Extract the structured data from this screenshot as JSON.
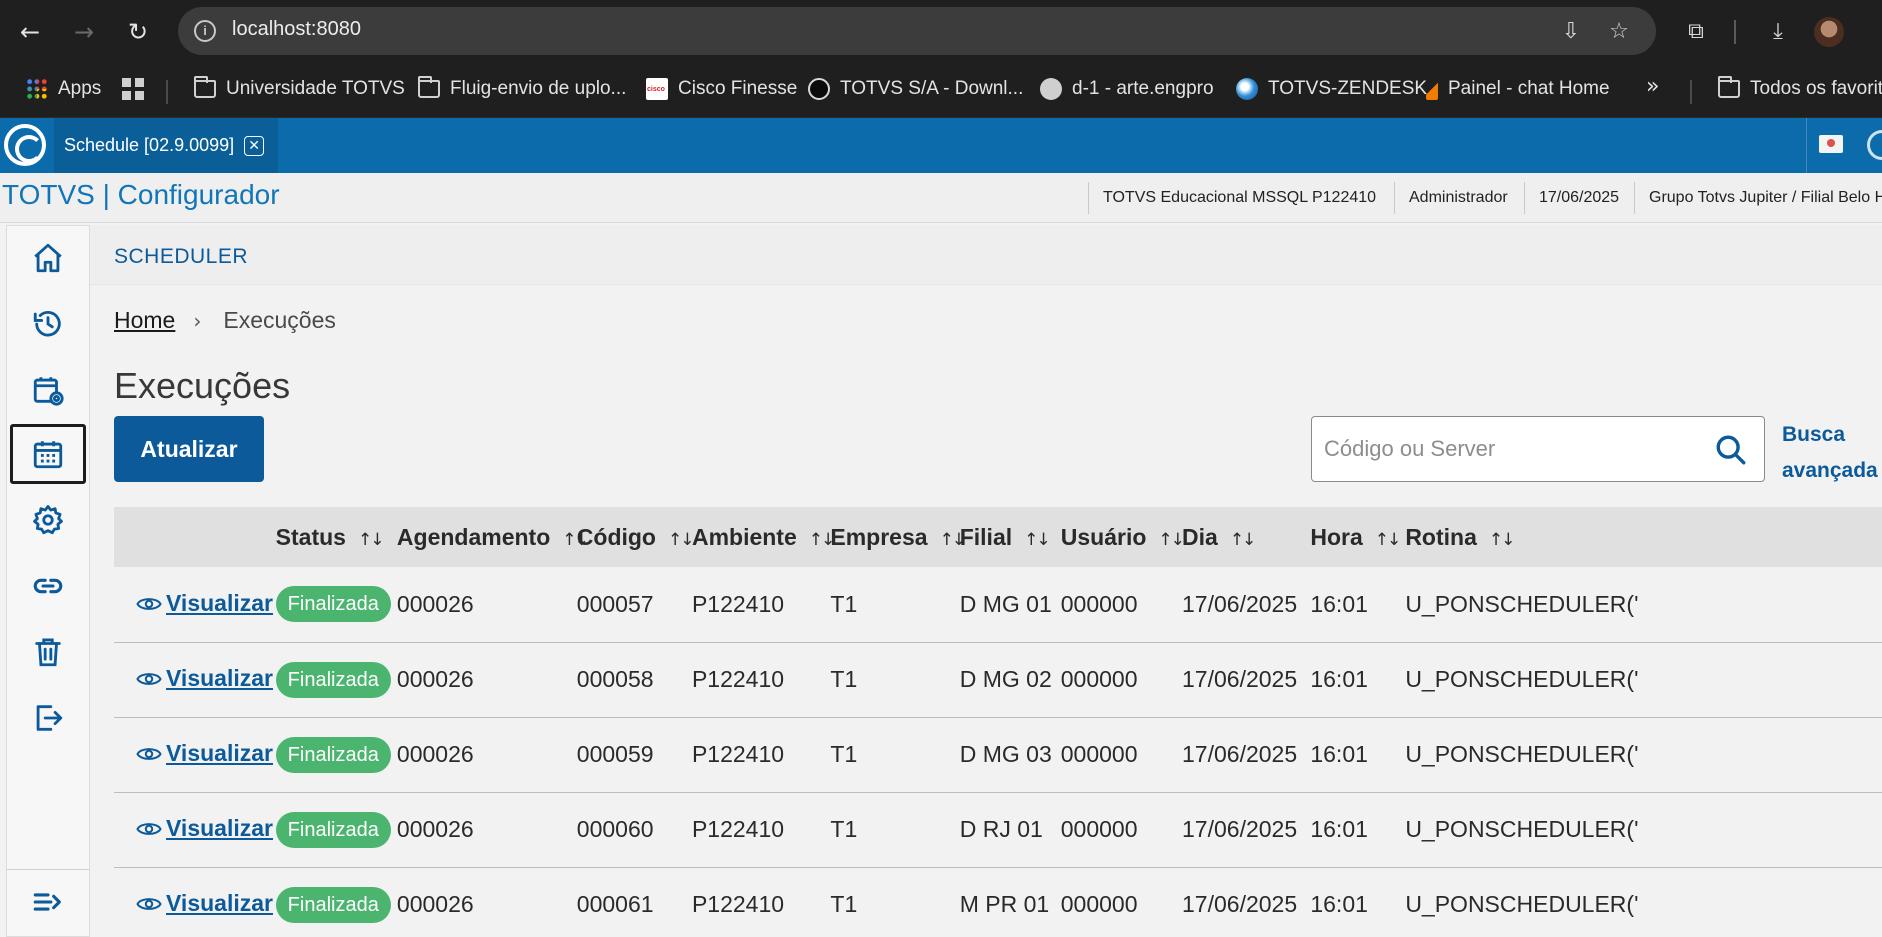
{
  "browser": {
    "url": "localhost:8080",
    "bookmarks": [
      {
        "label": "Apps",
        "icon": "apps-icon"
      },
      {
        "label": "",
        "icon": "grid-icon"
      },
      {
        "label": "Universidade TOTVS",
        "icon": "folder-icon"
      },
      {
        "label": "Fluig-envio de uplo...",
        "icon": "folder-icon"
      },
      {
        "label": "Cisco Finesse",
        "icon": "cisco-icon"
      },
      {
        "label": "TOTVS S/A - Downl...",
        "icon": "totvs-icon"
      },
      {
        "label": "d-1 - arte.engpro",
        "icon": "globe-icon"
      },
      {
        "label": "TOTVS-ZENDESK",
        "icon": "zendesk-icon"
      },
      {
        "label": "Painel - chat Home",
        "icon": "chat-icon"
      },
      {
        "label": "Todos os favoritos",
        "icon": "folder-icon"
      }
    ]
  },
  "app": {
    "tab_label": "Schedule [02.9.0099]",
    "title": "TOTVS | Configurador",
    "header_info": [
      "TOTVS Educacional MSSQL P122410",
      "Administrador",
      "17/06/2025",
      "Grupo Totvs Jupiter / Filial Belo Horizonte"
    ]
  },
  "sidebar": {
    "items": [
      {
        "name": "home",
        "icon": "home-icon"
      },
      {
        "name": "history",
        "icon": "history-icon"
      },
      {
        "name": "schedule-settings",
        "icon": "calendar-gear-icon"
      },
      {
        "name": "executions",
        "icon": "calendar-icon",
        "active": true
      },
      {
        "name": "settings",
        "icon": "gear-icon"
      },
      {
        "name": "links",
        "icon": "link-icon"
      },
      {
        "name": "delete",
        "icon": "trash-icon"
      },
      {
        "name": "logout",
        "icon": "logout-icon"
      },
      {
        "name": "collapse",
        "icon": "menu-collapse-icon"
      }
    ]
  },
  "main": {
    "section_title": "SCHEDULER",
    "breadcrumb": {
      "home": "Home",
      "current": "Execuções"
    },
    "page_title": "Execuções",
    "refresh_label": "Atualizar",
    "search_placeholder": "Código ou Server",
    "advanced_search_line1": "Busca",
    "advanced_search_line2": "avançada",
    "table": {
      "columns": [
        "Status",
        "Agendamento",
        "Código",
        "Ambiente",
        "Empresa",
        "Filial",
        "Usuário",
        "Dia",
        "Hora",
        "Rotina"
      ],
      "view_label": "Visualizar",
      "rows": [
        {
          "status": "Finalizada",
          "agendamento": "000026",
          "codigo": "000057",
          "ambiente": "P122410",
          "empresa": "T1",
          "filial": "D MG 01",
          "usuario": "000000",
          "dia": "17/06/2025",
          "hora": "16:01",
          "rotina": "U_PONSCHEDULER('"
        },
        {
          "status": "Finalizada",
          "agendamento": "000026",
          "codigo": "000058",
          "ambiente": "P122410",
          "empresa": "T1",
          "filial": "D MG 02",
          "usuario": "000000",
          "dia": "17/06/2025",
          "hora": "16:01",
          "rotina": "U_PONSCHEDULER('"
        },
        {
          "status": "Finalizada",
          "agendamento": "000026",
          "codigo": "000059",
          "ambiente": "P122410",
          "empresa": "T1",
          "filial": "D MG 03",
          "usuario": "000000",
          "dia": "17/06/2025",
          "hora": "16:01",
          "rotina": "U_PONSCHEDULER('"
        },
        {
          "status": "Finalizada",
          "agendamento": "000026",
          "codigo": "000060",
          "ambiente": "P122410",
          "empresa": "T1",
          "filial": "D RJ 01",
          "usuario": "000000",
          "dia": "17/06/2025",
          "hora": "16:01",
          "rotina": "U_PONSCHEDULER('"
        },
        {
          "status": "Finalizada",
          "agendamento": "000026",
          "codigo": "000061",
          "ambiente": "P122410",
          "empresa": "T1",
          "filial": "M PR 01",
          "usuario": "000000",
          "dia": "17/06/2025",
          "hora": "16:01",
          "rotina": "U_PONSCHEDULER('"
        }
      ]
    }
  }
}
